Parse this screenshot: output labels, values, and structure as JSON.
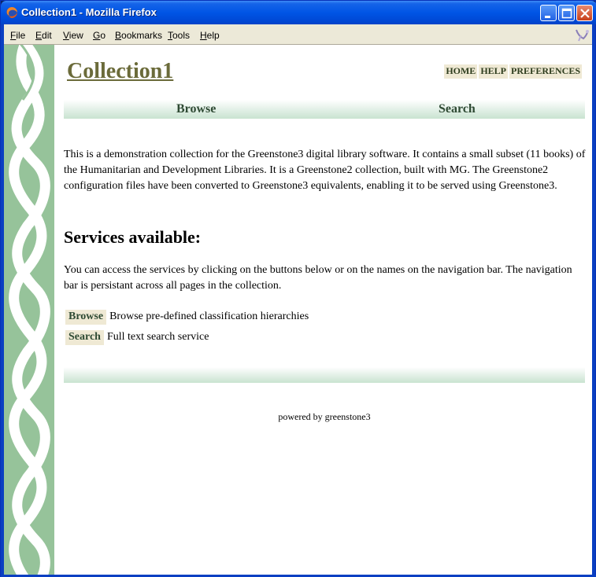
{
  "window": {
    "title": "Collection1 - Mozilla Firefox"
  },
  "menu": {
    "items": [
      {
        "u": "F",
        "rest": "ile"
      },
      {
        "u": "E",
        "rest": "dit"
      },
      {
        "u": "V",
        "rest": "iew"
      },
      {
        "u": "G",
        "rest": "o"
      },
      {
        "u": "B",
        "rest": "ookmarks"
      },
      {
        "u": "T",
        "rest": "ools"
      },
      {
        "u": "H",
        "rest": "elp"
      }
    ]
  },
  "page": {
    "collection_title": "Collection1",
    "top_nav": {
      "home": "HOME",
      "help": "HELP",
      "preferences": "PREFERENCES"
    },
    "navbar": {
      "browse": "Browse",
      "search": "Search"
    },
    "intro": "This is a demonstration collection for the Greenstone3 digital library software. It contains a small subset (11 books) of the Humanitarian and Development Libraries. It is a Greenstone2 collection, built with MG. The Greenstone2 configuration files have been converted to Greenstone3 equivalents, enabling it to be served using Greenstone3.",
    "services_heading": "Services available:",
    "access_text": "You can access the services by clicking on the buttons below or on the names on the navigation bar. The navigation bar is persistant across all pages in the collection.",
    "services": [
      {
        "button": "Browse",
        "description": "Browse pre-defined classification hierarchies"
      },
      {
        "button": "Search",
        "description": "Full text search service"
      }
    ],
    "powered_by": "powered by greenstone3"
  },
  "colors": {
    "titlebar": "#0055e5",
    "sidebar": "#96c39a",
    "collection_title": "#6b6b3a",
    "nav_button_bg": "#efe9d4"
  }
}
